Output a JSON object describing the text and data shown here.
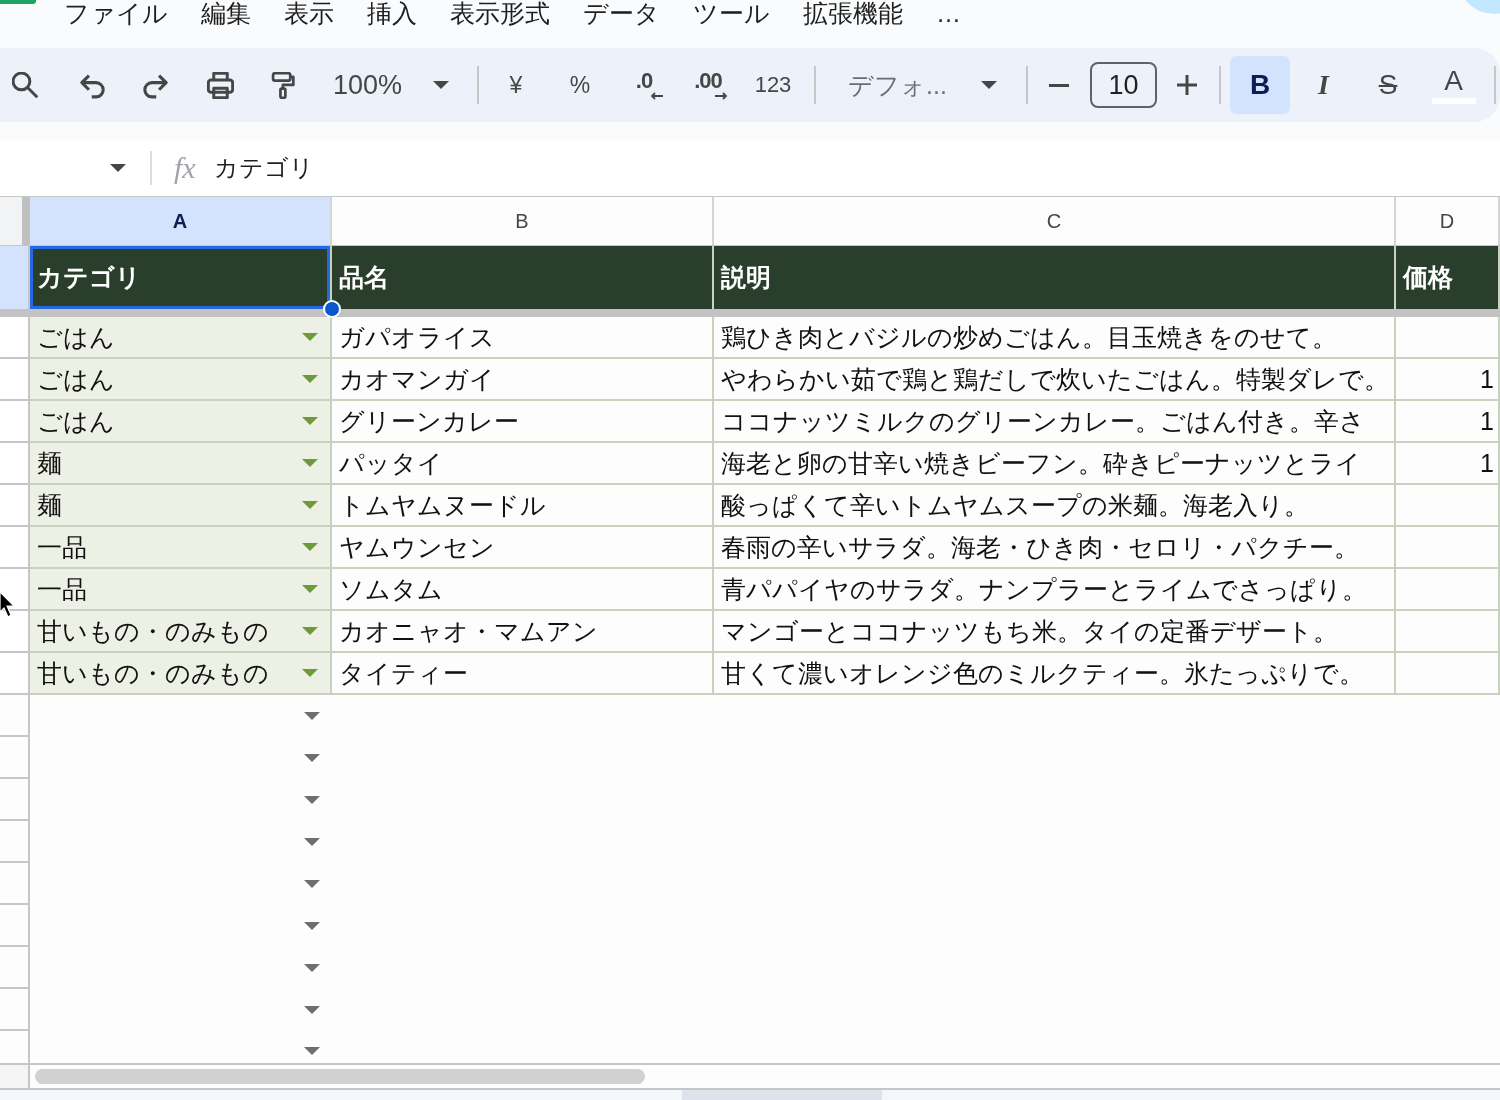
{
  "menu_bar": {
    "items": [
      "ファイル",
      "編集",
      "表示",
      "挿入",
      "表示形式",
      "データ",
      "ツール",
      "拡張機能",
      "…"
    ]
  },
  "toolbar": {
    "zoom": "100%",
    "number_buttons": [
      {
        "kind": "currency",
        "label": "¥"
      },
      {
        "kind": "percent",
        "label": "%"
      },
      {
        "kind": "decrease_decimal",
        "label": ".0"
      },
      {
        "kind": "increase_decimal",
        "label": ".00"
      },
      {
        "kind": "format",
        "label": "123"
      }
    ],
    "font": "デフォ...",
    "font_size": "10",
    "format_buttons": [
      {
        "kind": "bold",
        "label": "B",
        "selected": true
      },
      {
        "kind": "italic",
        "label": "I",
        "selected": false
      },
      {
        "kind": "strikethrough",
        "label": "S",
        "selected": false
      },
      {
        "kind": "text_color",
        "label": "A",
        "selected": false
      }
    ]
  },
  "formula_bar": {
    "fx_label": "fx",
    "formula": "カテゴリ"
  },
  "sheet": {
    "columns": [
      {
        "label": "A",
        "selected": true
      },
      {
        "label": "B",
        "selected": false
      },
      {
        "label": "C",
        "selected": false
      },
      {
        "label": "D",
        "selected": false
      }
    ],
    "header_row": {
      "selected": true,
      "cells": [
        {
          "text": "カテゴリ",
          "selected": true
        },
        {
          "text": "品名",
          "selected": false
        },
        {
          "text": "説明",
          "selected": false
        },
        {
          "text": "価格",
          "selected": false
        }
      ]
    },
    "rows": [
      {
        "selected": false,
        "category": "ごはん",
        "dropdown": true,
        "name": "ガパオライス",
        "description": "鶏ひき肉とバジルの炒めごはん。目玉焼きをのせて。"
      },
      {
        "selected": false,
        "category": "ごはん",
        "dropdown": true,
        "name": "カオマンガイ",
        "description": "やわらかい茹で鶏と鶏だしで炊いたごはん。特製ダレで。",
        "price": "1"
      },
      {
        "selected": false,
        "category": "ごはん",
        "dropdown": true,
        "name": "グリーンカレー",
        "description": "ココナッツミルクのグリーンカレー。ごはん付き。辛さ",
        "price": "1"
      },
      {
        "selected": false,
        "category": "麺",
        "dropdown": true,
        "name": "パッタイ",
        "description": "海老と卵の甘辛い焼きビーフン。砕きピーナッツとライ",
        "price": "1"
      },
      {
        "selected": false,
        "category": "麺",
        "dropdown": true,
        "name": "トムヤムヌードル",
        "description": "酸っぱくて辛いトムヤムスープの米麺。海老入り。"
      },
      {
        "selected": false,
        "category": "一品",
        "dropdown": true,
        "name": "ヤムウンセン",
        "description": "春雨の辛いサラダ。海老・ひき肉・セロリ・パクチー。"
      },
      {
        "selected": false,
        "category": "一品",
        "dropdown": true,
        "name": "ソムタム",
        "description": "青パパイヤのサラダ。ナンプラーとライムでさっぱり。"
      },
      {
        "selected": false,
        "category": "甘いもの・のみもの",
        "dropdown": true,
        "name": "カオニャオ・マムアン",
        "description": "マンゴーとココナッツもち米。タイの定番デザート。"
      },
      {
        "selected": false,
        "category": "甘いもの・のみもの",
        "dropdown": true,
        "name": "タイティー",
        "description": "甘くて濃いオレンジ色のミルクティー。氷たっぷりで。"
      }
    ],
    "empty_rows": [
      {
        "selected": false,
        "dropdown": true
      },
      {
        "selected": false,
        "dropdown": true
      },
      {
        "selected": false,
        "dropdown": true
      },
      {
        "selected": false,
        "dropdown": true
      },
      {
        "selected": false,
        "dropdown": true
      },
      {
        "selected": false,
        "dropdown": true
      },
      {
        "selected": false,
        "dropdown": true
      },
      {
        "selected": false,
        "dropdown": true
      },
      {
        "selected": false,
        "dropdown": true
      }
    ]
  }
}
